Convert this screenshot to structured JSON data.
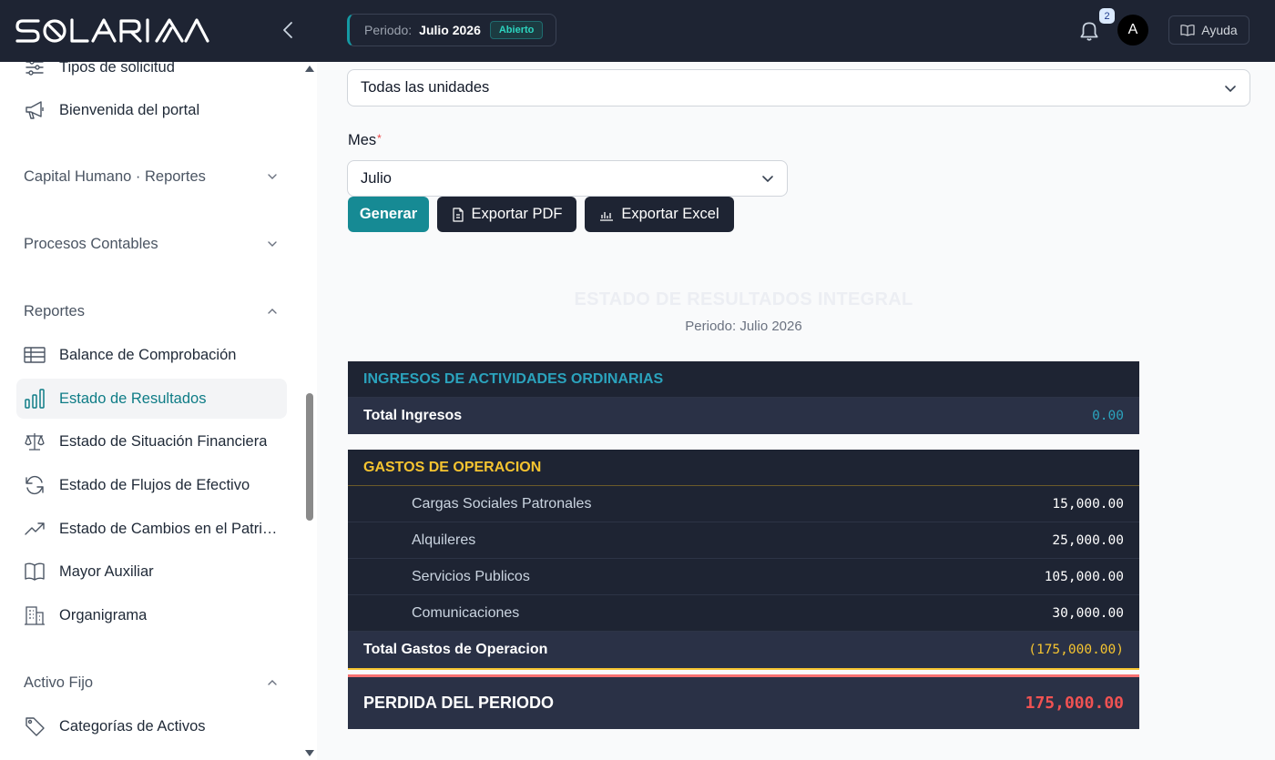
{
  "app": {
    "logo_text": "SOLARIA"
  },
  "topbar": {
    "period_label": "Periodo:",
    "period_value": "Julio 2026",
    "period_status": "Abierto",
    "notifications_count": "2",
    "avatar_initial": "A",
    "help_label": "Ayuda"
  },
  "sidebar": {
    "items_top": [
      {
        "label": "Tipos de solicitud",
        "icon": "sliders-icon"
      },
      {
        "label": "Bienvenida del portal",
        "icon": "megaphone-icon"
      }
    ],
    "sections": [
      {
        "label": "Capital Humano · Reportes",
        "state": "collapsed"
      },
      {
        "label": "Procesos Contables",
        "state": "collapsed"
      },
      {
        "label": "Reportes",
        "state": "expanded"
      },
      {
        "label": "Activo Fijo",
        "state": "expanded"
      }
    ],
    "report_items": [
      {
        "label": "Balance de Comprobación",
        "icon": "table-icon"
      },
      {
        "label": "Estado de Resultados",
        "icon": "bar-chart-icon",
        "active": true
      },
      {
        "label": "Estado de Situación Financiera",
        "icon": "scale-icon"
      },
      {
        "label": "Estado de Flujos de Efectivo",
        "icon": "refresh-icon"
      },
      {
        "label": "Estado de Cambios en el Patrimonio",
        "icon": "trending-up-icon"
      },
      {
        "label": "Mayor Auxiliar",
        "icon": "book-icon"
      },
      {
        "label": "Organigrama",
        "icon": "building-icon"
      }
    ],
    "asset_items": [
      {
        "label": "Categorías de Activos",
        "icon": "tag-icon"
      }
    ]
  },
  "filters": {
    "unit_value": "Todas las unidades",
    "month_label": "Mes",
    "month_required": "*",
    "month_value": "Julio"
  },
  "actions": {
    "generate": "Generar",
    "export_pdf": "Exportar PDF",
    "export_excel": "Exportar Excel"
  },
  "report": {
    "title": "ESTADO DE RESULTADOS INTEGRAL",
    "period": "Periodo: Julio 2026",
    "income": {
      "header": "INGRESOS DE ACTIVIDADES ORDINARIAS",
      "total_label": "Total Ingresos",
      "total_value": "0.00"
    },
    "expenses": {
      "header": "GASTOS DE OPERACION",
      "items": [
        {
          "label": "Cargas Sociales Patronales",
          "value": "15,000.00"
        },
        {
          "label": "Alquileres",
          "value": "25,000.00"
        },
        {
          "label": "Servicios Publicos",
          "value": "105,000.00"
        },
        {
          "label": "Comunicaciones",
          "value": "30,000.00"
        }
      ],
      "total_label": "Total Gastos de Operacion",
      "total_value": "(175,000.00)"
    },
    "result": {
      "label": "PERDIDA DEL PERIODO",
      "value": "175,000.00"
    }
  },
  "colors": {
    "accent": "#168a94",
    "dark": "#1e2433",
    "gold": "#f5c430",
    "loss_red": "#f05252"
  }
}
